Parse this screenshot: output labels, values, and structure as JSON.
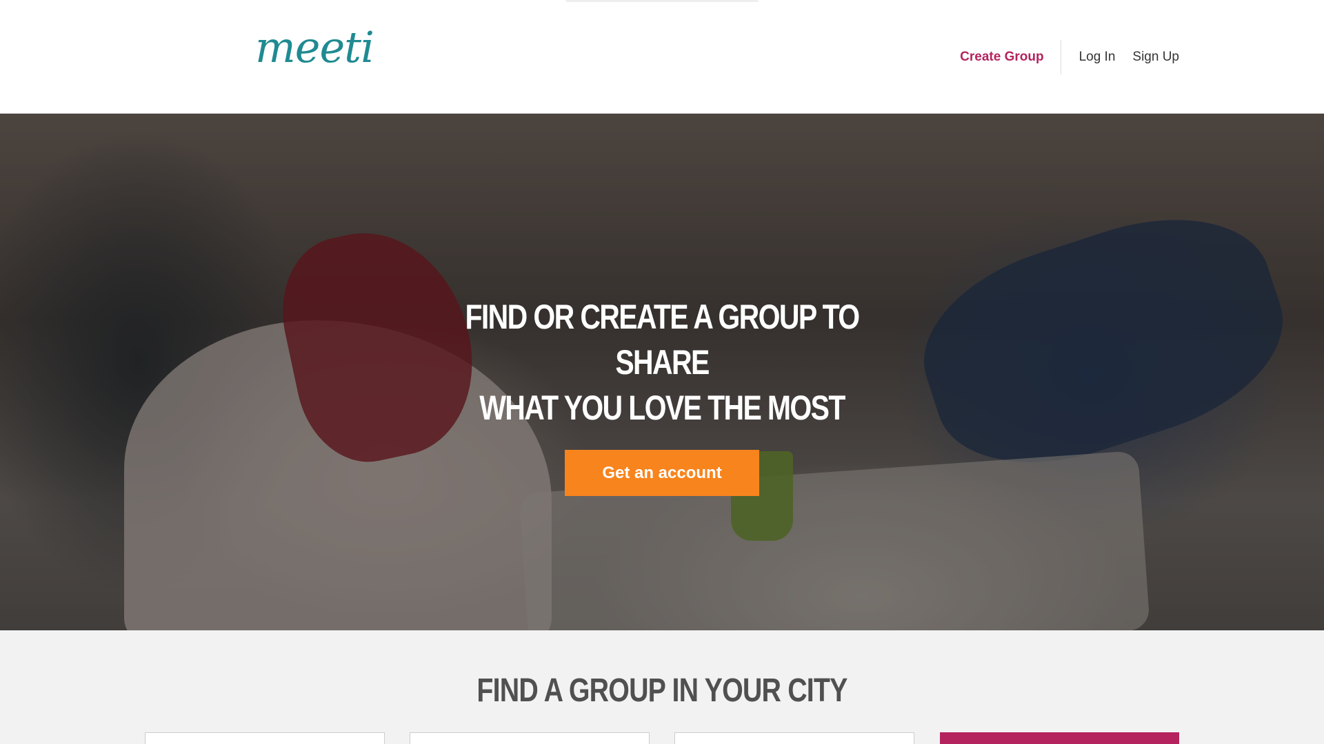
{
  "header": {
    "logo_text": "meeti",
    "nav": {
      "create_group": "Create Group",
      "log_in": "Log In",
      "sign_up": "Sign Up"
    }
  },
  "hero": {
    "title_line1": "Find or create a group to share",
    "title_line2": "what you love the most",
    "cta_label": "Get an account"
  },
  "find_section": {
    "title": "Find a group in your city"
  },
  "colors": {
    "brand_teal": "#1f8a92",
    "accent_magenta": "#b5235e",
    "cta_orange": "#f8841d"
  }
}
